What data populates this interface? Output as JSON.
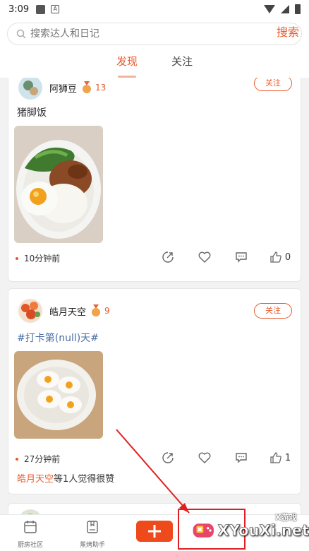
{
  "status_bar": {
    "time": "3:09"
  },
  "search": {
    "placeholder": "搜索达人和日记",
    "button_label": "搜索"
  },
  "tabs": [
    {
      "label": "发现",
      "active": true
    },
    {
      "label": "关注",
      "active": false
    }
  ],
  "posts": [
    {
      "username": "阿狮豆",
      "level": "13",
      "follow_label": "关注",
      "text": "猪脚饭",
      "time": "10分钟前",
      "like_count": "0"
    },
    {
      "username": "皓月天空",
      "level": "9",
      "follow_label": "关注",
      "text": "#打卡第(null)天#",
      "time": "27分钟前",
      "like_count": "1",
      "liked_by": {
        "name": "皓月天空",
        "suffix": "等1人觉得很赞"
      }
    }
  ],
  "bottom_nav": {
    "items": [
      {
        "label": "厨房社区"
      },
      {
        "label": "蒸烤助手"
      }
    ]
  },
  "watermark": {
    "text": "XYouXi.net",
    "small": "X游戏"
  },
  "colors": {
    "accent": "#e65a2c",
    "add_button": "#ee4a1c",
    "topic": "#4a6fa5"
  }
}
